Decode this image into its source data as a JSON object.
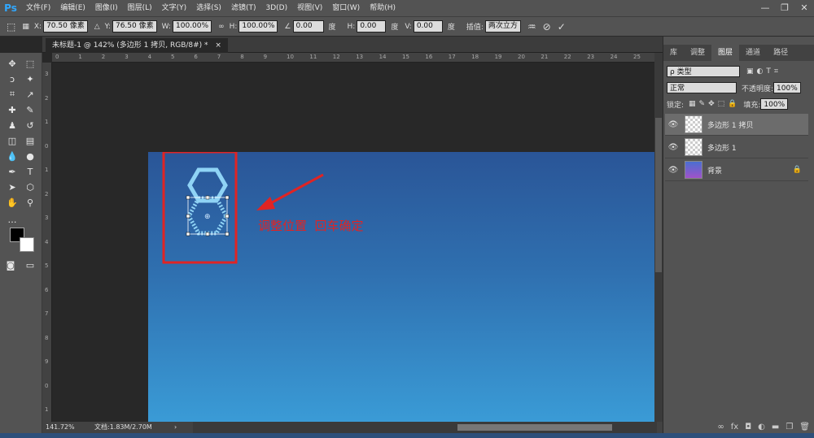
{
  "app": {
    "logo": "Ps"
  },
  "menu": [
    "文件(F)",
    "编辑(E)",
    "图像(I)",
    "图层(L)",
    "文字(Y)",
    "选择(S)",
    "滤镜(T)",
    "3D(D)",
    "视图(V)",
    "窗口(W)",
    "帮助(H)"
  ],
  "window_controls": {
    "minimize": "—",
    "maximize": "❐",
    "close": "✕"
  },
  "options": {
    "x_label": "X:",
    "x_value": "70.50 像素",
    "y_label": "Y:",
    "y_value": "76.50 像素",
    "w_label": "W:",
    "w_value": "100.00%",
    "h_label": "H:",
    "h_value": "100.00%",
    "angle_value": "0.00",
    "angle_unit": "度",
    "hskew_label": "H:",
    "hskew_value": "0.00",
    "hskew_unit": "度",
    "vskew_label": "V:",
    "vskew_value": "0.00",
    "vskew_unit": "度",
    "interp_label": "插值:",
    "interp_value": "两次立方"
  },
  "document": {
    "tab_title": "未标题-1 @ 142% (多边形 1 拷贝, RGB/8#) *",
    "close": "×"
  },
  "ruler_top_ticks": [
    "0",
    "1",
    "2",
    "3",
    "4",
    "5",
    "6",
    "7",
    "8",
    "9",
    "10",
    "11",
    "12",
    "13",
    "14",
    "15",
    "16",
    "17",
    "18",
    "19",
    "20",
    "21",
    "22",
    "23",
    "24",
    "25"
  ],
  "ruler_left_ticks": [
    "3",
    "2",
    "1",
    "0",
    "1",
    "2",
    "3",
    "4",
    "5",
    "6",
    "7",
    "8",
    "9",
    "0",
    "1"
  ],
  "annotation": {
    "text": "调整位置  回车确定",
    "color": "#e02424"
  },
  "status": {
    "zoom": "141.72%",
    "doc_info": "文档:1.83M/2.70M",
    "arrow": "›"
  },
  "panel": {
    "tabs": [
      "库",
      "调整",
      "图层",
      "通道",
      "路径"
    ],
    "active_tab": "图层",
    "filter_label": "ρ 类型",
    "blend_mode": "正常",
    "opacity_label": "不透明度:",
    "opacity_value": "100%",
    "lock_label": "锁定:",
    "fill_label": "填充:",
    "fill_value": "100%",
    "layers": [
      {
        "name": "多边形 1 拷贝",
        "selected": true
      },
      {
        "name": "多边形 1",
        "selected": false
      },
      {
        "name": "背景",
        "selected": false,
        "locked": true
      }
    ]
  },
  "colors": {
    "accent": "#31a8ff",
    "annotation_red": "#e02424",
    "shape_stroke": "#8fd3f5"
  }
}
